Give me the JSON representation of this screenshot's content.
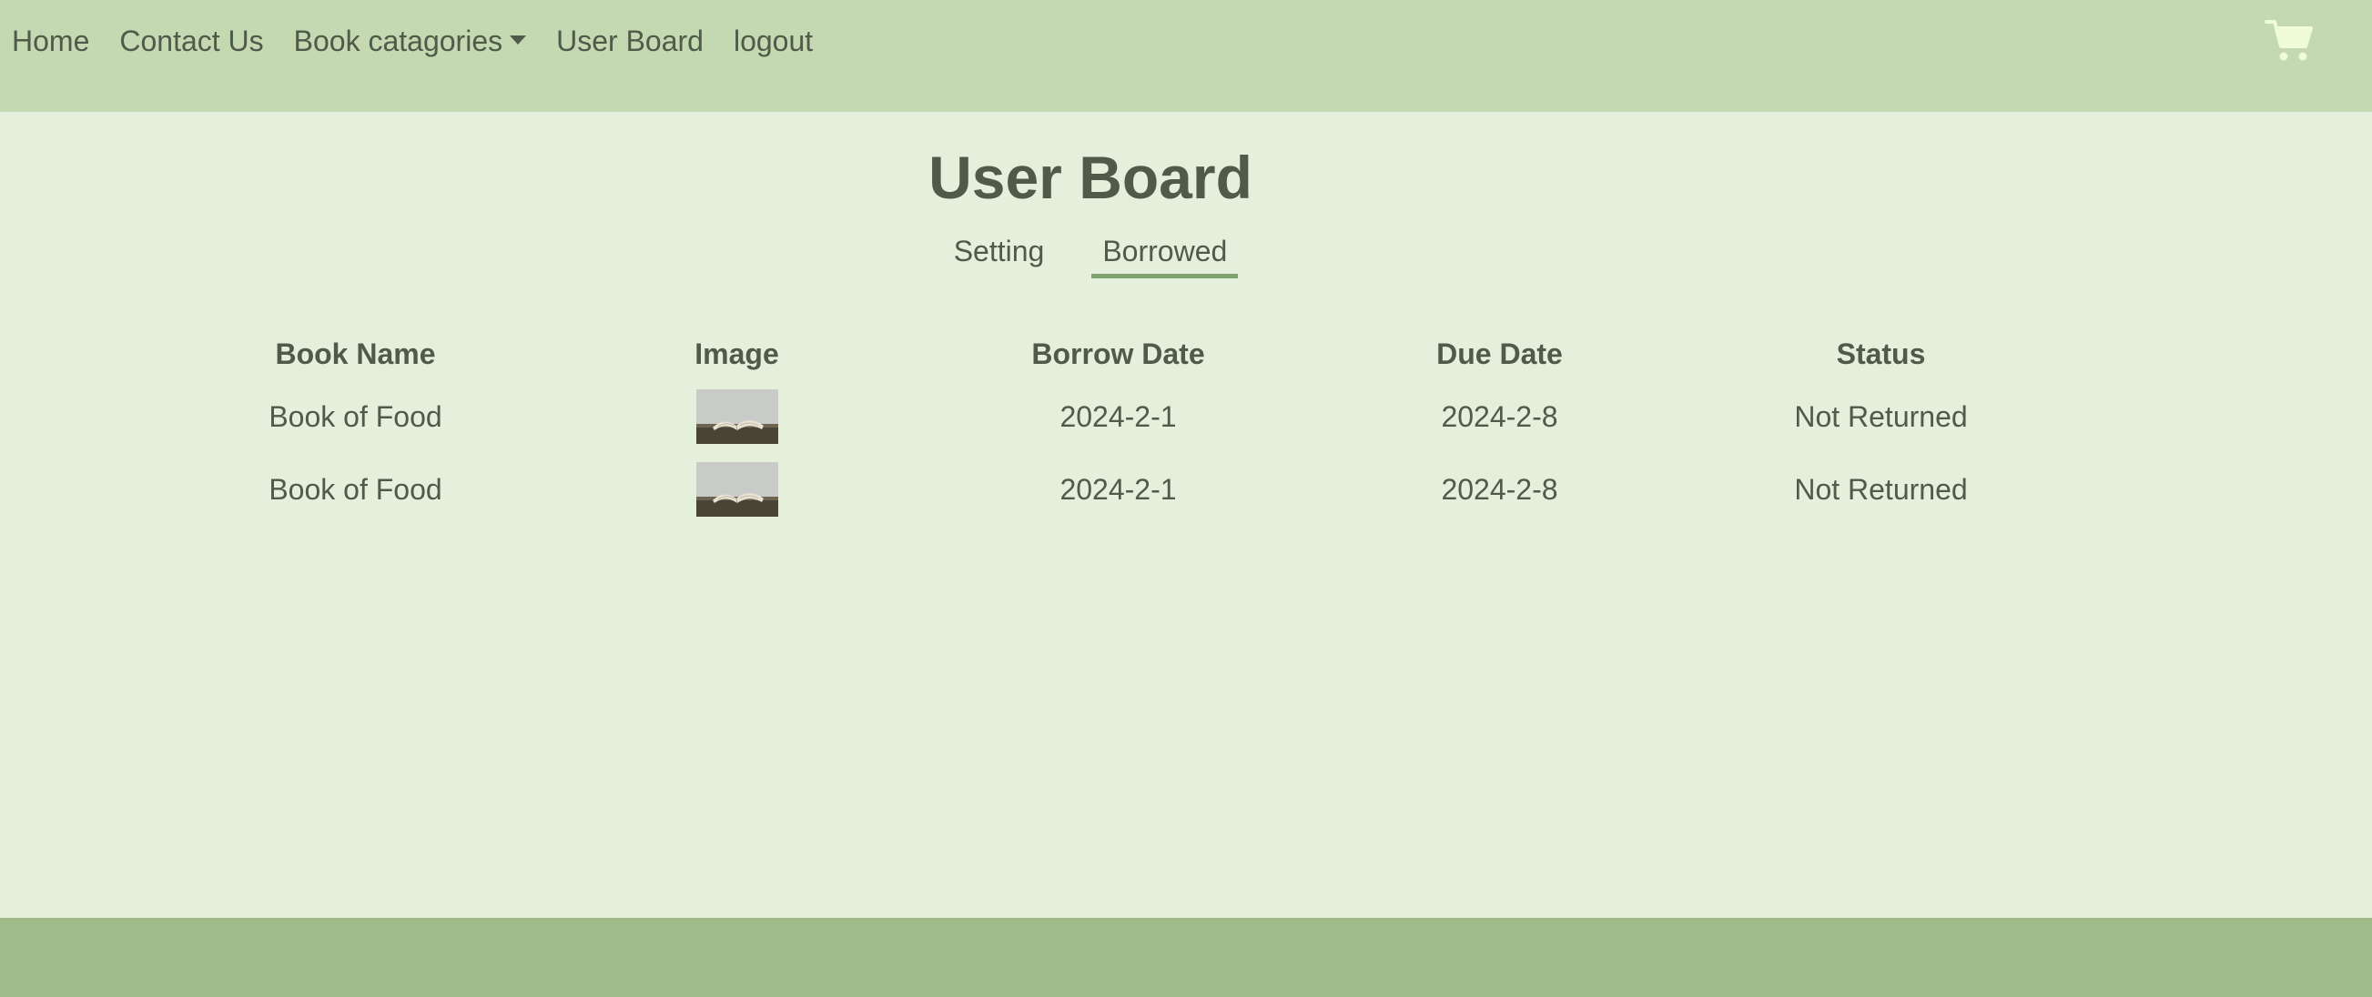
{
  "nav": {
    "links": [
      {
        "label": "Home"
      },
      {
        "label": "Contact Us"
      },
      {
        "label": "Book catagories"
      },
      {
        "label": "User Board"
      },
      {
        "label": "logout"
      }
    ],
    "cart_icon": "shopping-cart-icon",
    "cart_color": "#f0fbd8"
  },
  "page": {
    "title": "User Board",
    "tabs": [
      {
        "label": "Setting",
        "active": false
      },
      {
        "label": "Borrowed",
        "active": true
      }
    ]
  },
  "table": {
    "headers": [
      "Book Name",
      "Image",
      "Borrow Date",
      "Due Date",
      "Status"
    ],
    "rows": [
      {
        "book_name": "Book of Food",
        "image": "open-book-photo",
        "borrow_date": "2024-2-1",
        "due_date": "2024-2-8",
        "status": "Not Returned"
      },
      {
        "book_name": "Book of Food",
        "image": "open-book-photo",
        "borrow_date": "2024-2-1",
        "due_date": "2024-2-8",
        "status": "Not Returned"
      }
    ]
  },
  "colors": {
    "navbar": "#c4d8b2",
    "background": "#e4efdc",
    "footer": "#9fbb8a",
    "text": "#4f5a48",
    "status_not_returned": "#d98d8d",
    "tab_underline": "#7fa36e"
  }
}
